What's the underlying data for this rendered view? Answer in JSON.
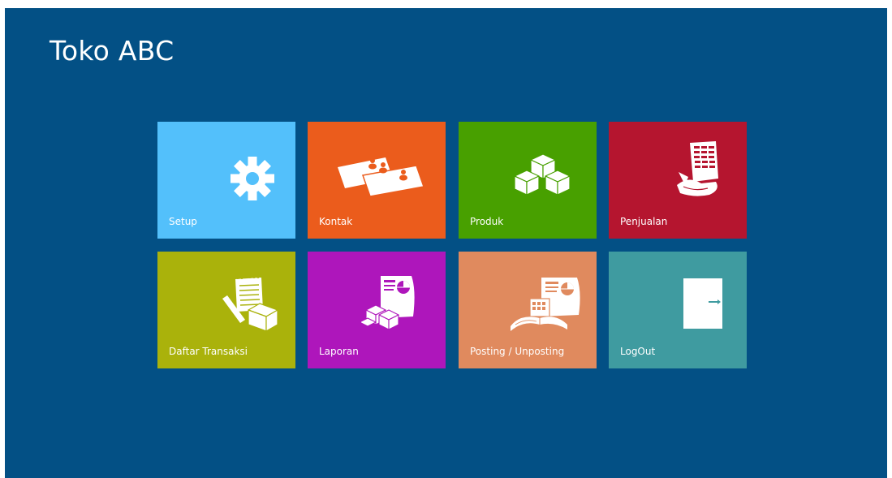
{
  "app": {
    "title": "Toko ABC",
    "background_color": "#035085"
  },
  "tiles": [
    {
      "label": "Setup",
      "color": "#53c0fb",
      "icon": "gear-icon"
    },
    {
      "label": "Kontak",
      "color": "#eb5c1c",
      "icon": "contact-cards-icon"
    },
    {
      "label": "Produk",
      "color": "#48a000",
      "icon": "boxes-icon"
    },
    {
      "label": "Penjualan",
      "color": "#b5152f",
      "icon": "sales-document-icon"
    },
    {
      "label": "Daftar Transaksi",
      "color": "#aab20b",
      "icon": "transaction-notepad-icon"
    },
    {
      "label": "Laporan",
      "color": "#ae16bb",
      "icon": "report-icon"
    },
    {
      "label": "Posting / Unposting",
      "color": "#e08a5e",
      "icon": "posting-calculator-icon"
    },
    {
      "label": "LogOut",
      "color": "#3f9ba0",
      "icon": "door-exit-icon"
    }
  ]
}
